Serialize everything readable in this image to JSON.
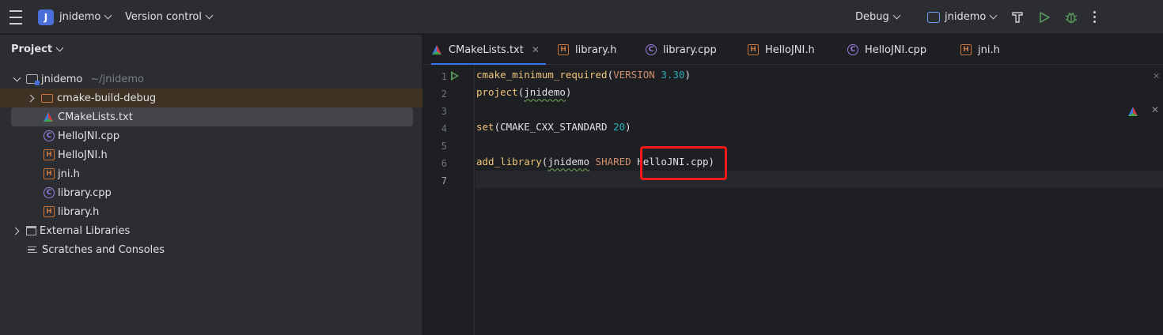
{
  "titlebar": {
    "project_badge": "J",
    "project_name": "jnidemo",
    "vcs_label": "Version control",
    "run_config": "Debug",
    "target_name": "jnidemo"
  },
  "project_panel": {
    "title": "Project",
    "tree": [
      {
        "label": "jnidemo",
        "sub": "~/jnidemo",
        "icon": "module-folder-icon"
      },
      {
        "label": "cmake-build-debug",
        "icon": "folder-icon"
      },
      {
        "label": "CMakeLists.txt",
        "icon": "cmake-icon"
      },
      {
        "label": "HelloJNI.cpp",
        "icon": "cpp-file-icon"
      },
      {
        "label": "HelloJNI.h",
        "icon": "header-file-icon"
      },
      {
        "label": "jni.h",
        "icon": "header-file-icon"
      },
      {
        "label": "library.cpp",
        "icon": "cpp-file-icon"
      },
      {
        "label": "library.h",
        "icon": "header-file-icon"
      },
      {
        "label": "External Libraries",
        "icon": "library-icon"
      },
      {
        "label": "Scratches and Consoles",
        "icon": "scratches-icon"
      }
    ]
  },
  "editor": {
    "tabs": [
      {
        "label": "CMakeLists.txt",
        "icon": "cmake-icon"
      },
      {
        "label": "library.h",
        "icon": "header-file-icon"
      },
      {
        "label": "library.cpp",
        "icon": "cpp-file-icon"
      },
      {
        "label": "HelloJNI.h",
        "icon": "header-file-icon"
      },
      {
        "label": "HelloJNI.cpp",
        "icon": "cpp-file-icon"
      },
      {
        "label": "jni.h",
        "icon": "header-file-icon"
      }
    ],
    "line_numbers": [
      "1",
      "2",
      "3",
      "4",
      "5",
      "6",
      "7"
    ],
    "code": {
      "l1_fn": "cmake_minimum_required",
      "l1_open": "(",
      "l1_kw": "VERSION",
      "l1_num": "3.30",
      "l1_close": ")",
      "l2_fn": "project",
      "l2_open": "(",
      "l2_arg": "jnidemo",
      "l2_close": ")",
      "l4_fn": "set",
      "l4_open": "(",
      "l4_arg": "CMAKE_CXX_STANDARD",
      "l4_num": "20",
      "l4_close": ")",
      "l6_fn": "add_library",
      "l6_open": "(",
      "l6_arg": "jnidemo",
      "l6_kw": "SHARED",
      "l6_file": "HelloJNI.cpp",
      "l6_close": ")"
    }
  },
  "colors": {
    "accent": "#3574f0",
    "highlight_box": "#ff1a1a",
    "run_green": "#57965c"
  }
}
